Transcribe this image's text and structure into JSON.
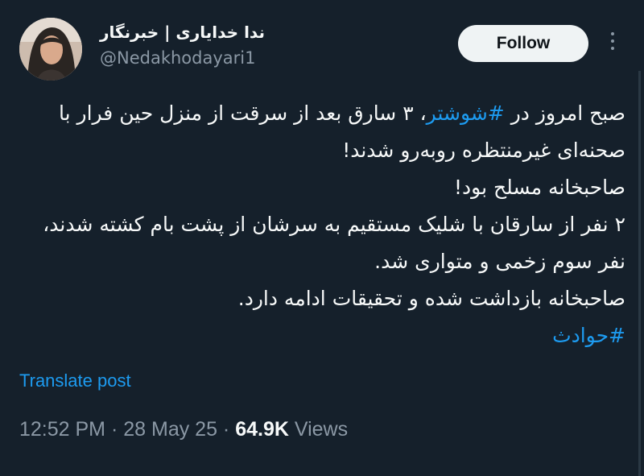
{
  "author": {
    "display_name": "ندا خدایاری | خبرنگار",
    "handle": "@Nedakhodayari1",
    "avatar_icon": "profile-photo"
  },
  "header": {
    "follow_label": "Follow",
    "more_icon": "more-dots-icon"
  },
  "tweet": {
    "line1_prefix": "صبح امروز در ",
    "line1_hashtag": "#شوشتر",
    "line1_suffix": "، ۳ سارق بعد از سرقت از منزل حین فرار با صحنه‌ای غیرمنتظره روبه‌رو شدند!",
    "line2": "صاحبخانه مسلح بود!",
    "line3": "۲ نفر از سارقان با شلیک مستقیم به سرشان از پشت بام کشته شدند، نفر سوم زخمی و متواری شد.",
    "line4": "صاحبخانه بازداشت شده و تحقیقات ادامه دارد.",
    "hashtag2": "#حوادث"
  },
  "translate_label": "Translate post",
  "meta": {
    "time": "12:52 PM",
    "separator": " · ",
    "date": "28 May 25",
    "views_count": "64.9K",
    "views_label": " Views"
  },
  "colors": {
    "background": "#15202b",
    "text": "#f7f9f9",
    "secondary": "#8b98a5",
    "link": "#1d9bf0",
    "follow_bg": "#eff3f4"
  }
}
